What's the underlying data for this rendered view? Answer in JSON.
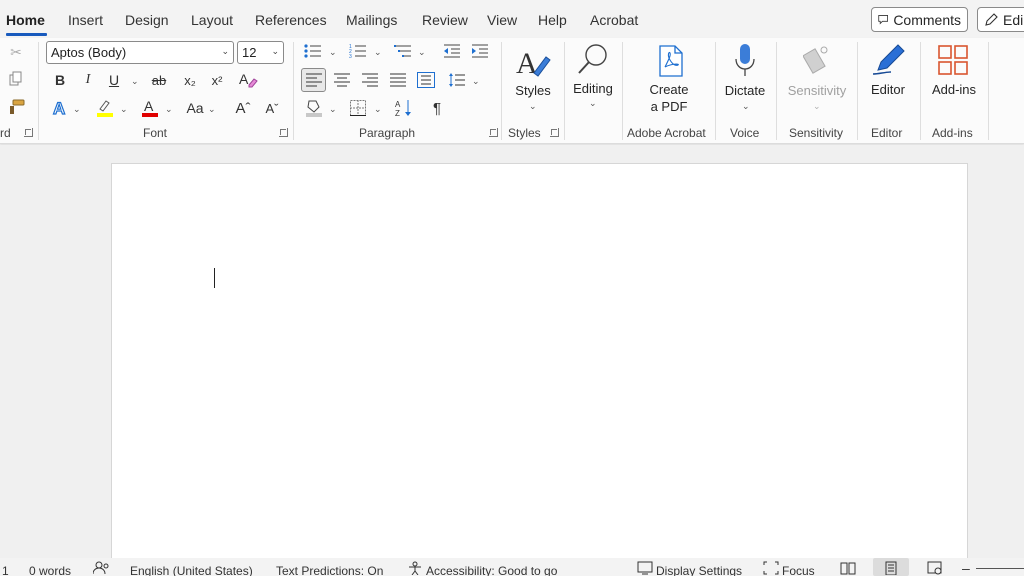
{
  "tabs": [
    "Home",
    "Insert",
    "Design",
    "Layout",
    "References",
    "Mailings",
    "Review",
    "View",
    "Help",
    "Acrobat"
  ],
  "top_buttons": {
    "comments": "Comments",
    "editing": "Edi"
  },
  "clipboard": {
    "label_fragment": "rd"
  },
  "font": {
    "name": "Aptos (Body)",
    "size": "12",
    "label": "Font",
    "bold": "B",
    "italic": "I",
    "underline": "U",
    "strike": "ab",
    "subscript": "x₂",
    "superscript": "x²",
    "change_case": "Aa",
    "grow": "Aˆ",
    "shrink": "Aˇ"
  },
  "paragraph": {
    "label": "Paragraph",
    "pilcrow": "¶"
  },
  "styles": {
    "button_label": "Styles",
    "group_label": "Styles"
  },
  "editing": {
    "button_label": "Editing"
  },
  "adobe": {
    "line1": "Create",
    "line2": "a PDF",
    "group_label": "Adobe Acrobat"
  },
  "voice": {
    "button_label": "Dictate",
    "group_label": "Voice"
  },
  "sensitivity": {
    "button_label": "Sensitivity",
    "group_label": "Sensitivity"
  },
  "editor": {
    "button_label": "Editor",
    "group_label": "Editor"
  },
  "addins": {
    "button_label": "Add-ins",
    "group_label": "Add-ins"
  },
  "status": {
    "page": "1",
    "words": "0 words",
    "language": "English (United States)",
    "predictions": "Text Predictions: On",
    "accessibility": "Accessibility: Good to go",
    "display_settings": "Display Settings",
    "focus": "Focus",
    "zoom_minus": "–"
  },
  "colors": {
    "accent": "#185abd",
    "highlight": "#ffff00",
    "font_color": "#e00000",
    "addins": "#d9562f"
  }
}
